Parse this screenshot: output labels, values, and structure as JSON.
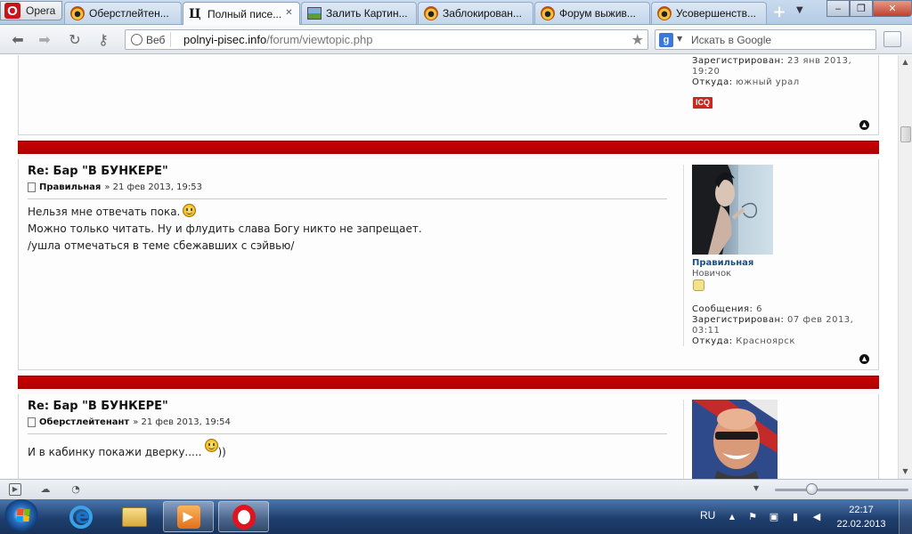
{
  "browser": {
    "menu_label": "Opera",
    "tabs": [
      {
        "title": "Оберстлейтен..."
      },
      {
        "title": "Полный писе..."
      },
      {
        "title": "Залить Картин..."
      },
      {
        "title": "Заблокирован..."
      },
      {
        "title": "Форум выжив..."
      },
      {
        "title": "Усовершенств..."
      }
    ],
    "new_tab": "+",
    "address": {
      "badge": "Веб",
      "domain": "polnyi-pisec.info",
      "path": "/forum/viewtopic.php"
    },
    "search": {
      "placeholder": "Искать в Google",
      "engine_letter": "g"
    }
  },
  "forum": {
    "prev_post": {
      "registered_label": "Зарегистрирован:",
      "registered_value_1": "23 янв 2013,",
      "registered_value_2": "19:20",
      "from_label": "Откуда:",
      "from_value": "южный урал",
      "icq": "ICQ"
    },
    "posts": [
      {
        "title": "Re: Бар \"В БУНКЕРЕ\"",
        "author": "Правильная",
        "date": "» 21 фев 2013, 19:53",
        "lines": [
          "Нельзя мне отвечать пока.",
          "Можно только читать. Ну и флудить слава Богу никто не запрещает.",
          "/ушла отмечаться в теме сбежавших с сэйвью/"
        ],
        "profile": {
          "name": "Правильная",
          "rank": "Новичок",
          "posts_label": "Сообщения:",
          "posts_value": "6",
          "registered_label": "Зарегистрирован:",
          "registered_value_1": "07 фев 2013,",
          "registered_value_2": "03:11",
          "from_label": "Откуда:",
          "from_value": "Красноярск"
        }
      },
      {
        "title": "Re: Бар \"В БУНКЕРЕ\"",
        "author": "Оберстлейтенант",
        "date": "» 21 фев 2013, 19:54",
        "line_before": "И в кабинку покажи дверку.....",
        "line_after": "))"
      }
    ]
  },
  "taskbar": {
    "language": "RU",
    "time": "22:17",
    "date": "22.02.2013"
  },
  "colors": {
    "post_header_red": "#b40202",
    "username_blue": "#1f4f7f",
    "taskbar": "#1f3f6e"
  }
}
